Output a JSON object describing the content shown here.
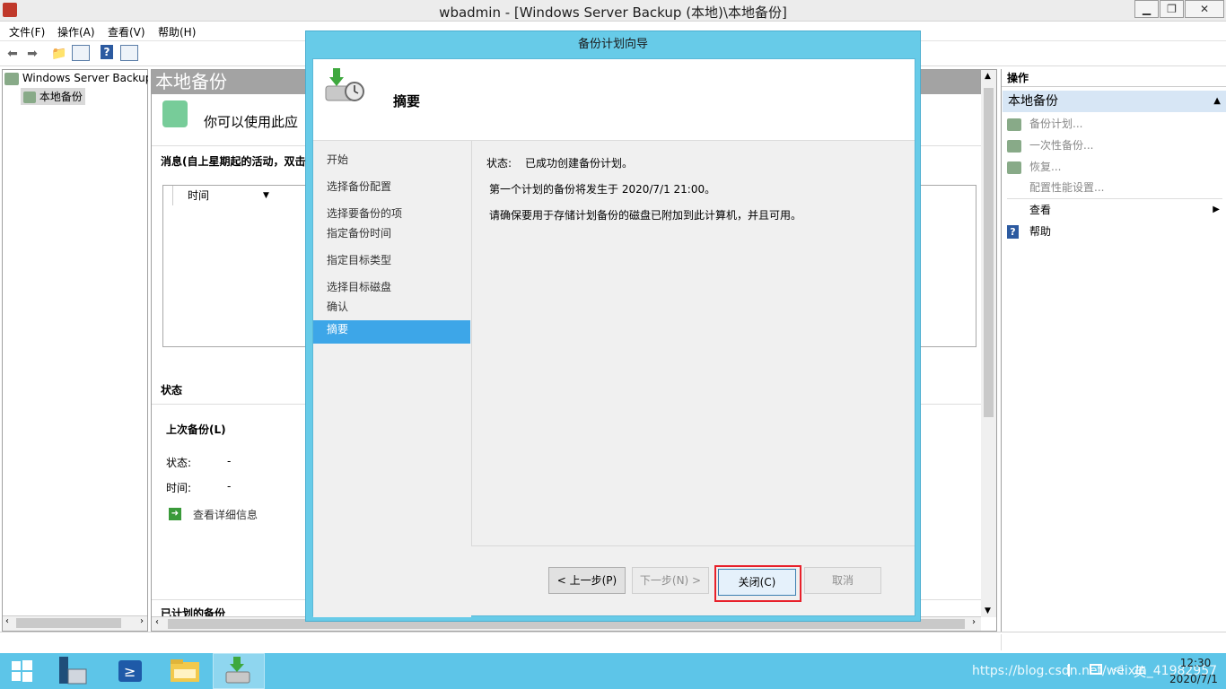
{
  "window": {
    "title": "wbadmin - [Windows Server Backup (本地)\\本地备份]"
  },
  "menu": [
    "文件(F)",
    "操作(A)",
    "查看(V)",
    "帮助(H)"
  ],
  "tree": {
    "root": "Windows Server Backup",
    "child": "本地备份"
  },
  "center": {
    "header": "本地备份",
    "intro": "你可以使用此应",
    "messages_heading": "消息(自上星期起的活动，双击",
    "messages_col_time": "时间",
    "status_heading": "状态",
    "last_backup_heading": "上次备份(L)",
    "status_label": "状态:",
    "status_value": "-",
    "time_label": "时间:",
    "time_value": "-",
    "details_link": "查看详细信息",
    "scheduled_heading": "已计划的备份"
  },
  "actions": {
    "header": "操作",
    "section": "本地备份",
    "items": [
      "备份计划...",
      "一次性备份...",
      "恢复...",
      "配置性能设置...",
      "查看",
      "帮助"
    ]
  },
  "wizard": {
    "title": "备份计划向导",
    "page_title": "摘要",
    "steps": [
      "开始",
      "选择备份配置",
      "选择要备份的项",
      "指定备份时间",
      "指定目标类型",
      "选择目标磁盘",
      "确认",
      "摘要"
    ],
    "selected_step": "摘要",
    "status_label": "状态:",
    "status_value": "已成功创建备份计划。",
    "line1": "第一个计划的备份将发生于 2020/7/1 21:00。",
    "line2": "请确保要用于存储计划备份的磁盘已附加到此计算机，并且可用。",
    "buttons": {
      "prev": "< 上一步(P)",
      "next": "下一步(N) >",
      "close": "关闭(C)",
      "cancel": "取消"
    },
    "highlight_color": "#e8202a"
  },
  "taskbar": {
    "time": "12:30",
    "date": "2020/7/1",
    "ime": "英",
    "watermark": "https://blog.csdn.net/weixin_41982957"
  },
  "colors": {
    "taskbar": "#5dc5e8",
    "wizard_frame": "#67cbe8",
    "selected_step": "#3da6e8",
    "section_header": "#d7e6f5"
  }
}
